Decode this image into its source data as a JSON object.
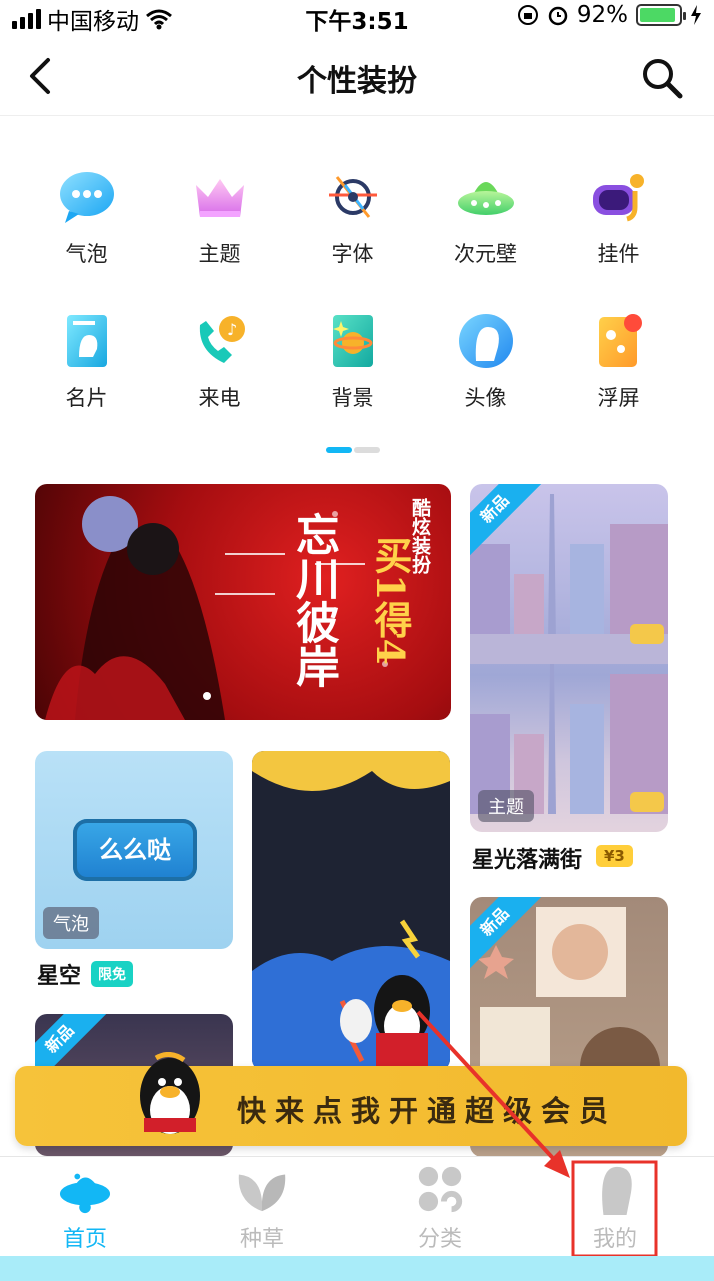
{
  "status_bar": {
    "carrier": "中国移动",
    "time": "下午3:51",
    "battery": "92%"
  },
  "header": {
    "title": "个性装扮"
  },
  "categories": [
    {
      "label": "气泡",
      "icon": "bubble-icon"
    },
    {
      "label": "主题",
      "icon": "crown-icon"
    },
    {
      "label": "字体",
      "icon": "font-icon"
    },
    {
      "label": "次元壁",
      "icon": "ufo-icon"
    },
    {
      "label": "挂件",
      "icon": "goggles-icon"
    },
    {
      "label": "名片",
      "icon": "card-icon"
    },
    {
      "label": "来电",
      "icon": "phone-icon"
    },
    {
      "label": "背景",
      "icon": "planet-icon"
    },
    {
      "label": "头像",
      "icon": "avatar-icon"
    },
    {
      "label": "浮屏",
      "icon": "float-screen-icon"
    }
  ],
  "banner": {
    "line1": "忘川彼岸",
    "line2": "酷炫装扮",
    "line3": "买1得4"
  },
  "items": {
    "city": {
      "new_tag": "新品",
      "type_tag": "主题",
      "title": "星光落满街",
      "price": "¥3"
    },
    "bubble": {
      "bubble_text": "么么哒",
      "type_tag": "气泡",
      "title": "星空",
      "badge": "限免"
    },
    "left_bottom": {
      "new_tag": "新品"
    },
    "right_bottom": {
      "new_tag": "新品"
    }
  },
  "vip": {
    "text": "快来点我开通超级会员"
  },
  "tabs": [
    {
      "label": "首页",
      "active": true
    },
    {
      "label": "种草",
      "active": false
    },
    {
      "label": "分类",
      "active": false
    },
    {
      "label": "我的",
      "active": false
    }
  ],
  "colors": {
    "accent": "#12b7f5",
    "vip": "#f6c33a",
    "annotation": "#e8322a"
  }
}
